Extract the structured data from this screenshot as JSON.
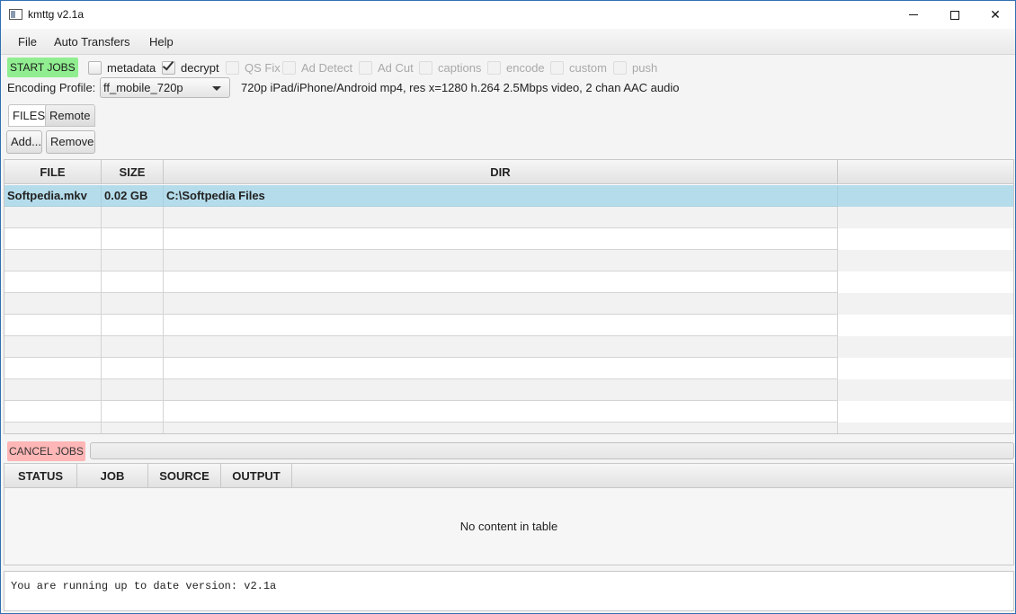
{
  "window": {
    "title": "kmttg v2.1a",
    "minimize_icon": "minimize-icon",
    "maximize_icon": "maximize-icon",
    "close_glyph": "✕"
  },
  "menu": [
    "File",
    "Auto Transfers",
    "Help"
  ],
  "toolbar": {
    "start_jobs": "START JOBS",
    "start_jobs_color": "#90ee90",
    "options": [
      {
        "label": "metadata",
        "checked": false,
        "enabled": true
      },
      {
        "label": "decrypt",
        "checked": true,
        "enabled": true
      },
      {
        "label": "QS Fix",
        "checked": false,
        "enabled": false
      },
      {
        "label": "Ad Detect",
        "checked": false,
        "enabled": false
      },
      {
        "label": "Ad Cut",
        "checked": false,
        "enabled": false
      },
      {
        "label": "captions",
        "checked": false,
        "enabled": false
      },
      {
        "label": "encode",
        "checked": false,
        "enabled": false
      },
      {
        "label": "custom",
        "checked": false,
        "enabled": false
      },
      {
        "label": "push",
        "checked": false,
        "enabled": false
      }
    ]
  },
  "encoding": {
    "label": "Encoding Profile:",
    "selected": "ff_mobile_720p",
    "description": "720p iPad/iPhone/Android mp4, res x=1280 h.264 2.5Mbps video, 2 chan AAC audio"
  },
  "tabs": [
    {
      "label": "FILES",
      "active": true
    },
    {
      "label": "Remote",
      "active": false
    }
  ],
  "file_buttons": {
    "add": "Add...",
    "remove": "Remove"
  },
  "files_table": {
    "columns": [
      "FILE",
      "SIZE",
      "DIR",
      ""
    ],
    "rows": [
      {
        "file": "Softpedia.mkv",
        "size": "0.02 GB",
        "dir": "C:\\Softpedia Files",
        "selected": true
      }
    ],
    "selection_color": "#b5dceb"
  },
  "jobs": {
    "cancel_label": "CANCEL JOBS",
    "cancel_color": "#ffb6b6",
    "progress": 0,
    "columns": [
      "STATUS",
      "JOB",
      "SOURCE",
      "OUTPUT"
    ],
    "empty_text": "No content in table"
  },
  "message": "You are running up to date version: v2.1a"
}
